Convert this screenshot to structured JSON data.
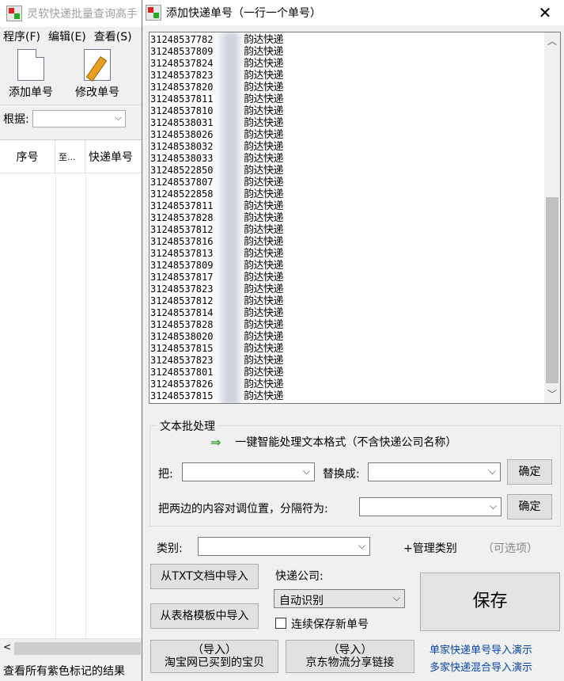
{
  "background_window": {
    "title": "灵软快递批量查询高手",
    "menu": [
      "程序(F)",
      "编辑(E)",
      "查看(S)"
    ],
    "toolbar": [
      "添加单号",
      "修改单号"
    ],
    "filter_label": "根据:",
    "grid_columns": [
      "序号",
      "至...",
      "快递单号"
    ],
    "status": "查看所有紫色标记的结果"
  },
  "dialog": {
    "title": "添加快递单号（一行一个单号）",
    "lines": [
      {
        "number": "31248537782",
        "carrier": "韵达快递"
      },
      {
        "number": "31248537809",
        "carrier": "韵达快递"
      },
      {
        "number": "31248537824",
        "carrier": "韵达快递"
      },
      {
        "number": "31248537823",
        "carrier": "韵达快递"
      },
      {
        "number": "31248537820",
        "carrier": "韵达快递"
      },
      {
        "number": "31248537811",
        "carrier": "韵达快递"
      },
      {
        "number": "31248537810",
        "carrier": "韵达快递"
      },
      {
        "number": "31248538031",
        "carrier": "韵达快递"
      },
      {
        "number": "31248538026",
        "carrier": "韵达快递"
      },
      {
        "number": "31248538032",
        "carrier": "韵达快递"
      },
      {
        "number": "31248538033",
        "carrier": "韵达快递"
      },
      {
        "number": "31248522850",
        "carrier": "韵达快递"
      },
      {
        "number": "31248537807",
        "carrier": "韵达快递"
      },
      {
        "number": "31248522858",
        "carrier": "韵达快递"
      },
      {
        "number": "31248537811",
        "carrier": "韵达快递"
      },
      {
        "number": "31248537828",
        "carrier": "韵达快递"
      },
      {
        "number": "31248537812",
        "carrier": "韵达快递"
      },
      {
        "number": "31248537816",
        "carrier": "韵达快递"
      },
      {
        "number": "31248537813",
        "carrier": "韵达快递"
      },
      {
        "number": "31248537809",
        "carrier": "韵达快递"
      },
      {
        "number": "31248537817",
        "carrier": "韵达快递"
      },
      {
        "number": "31248537823",
        "carrier": "韵达快递"
      },
      {
        "number": "31248537812",
        "carrier": "韵达快递"
      },
      {
        "number": "31248537814",
        "carrier": "韵达快递"
      },
      {
        "number": "31248537828",
        "carrier": "韵达快递"
      },
      {
        "number": "31248538020",
        "carrier": "韵达快递"
      },
      {
        "number": "31248537815",
        "carrier": "韵达快递"
      },
      {
        "number": "31248537823",
        "carrier": "韵达快递"
      },
      {
        "number": "31248537801",
        "carrier": "韵达快递"
      },
      {
        "number": "31248537826",
        "carrier": "韵达快递"
      },
      {
        "number": "31248537815",
        "carrier": "韵达快递"
      }
    ],
    "batch_group_label": "文本批处理",
    "one_click_label": "一键智能处理文本格式（不含快递公司名称）",
    "replace_label": "把:",
    "replace_with_label": "替换成:",
    "confirm_label": "确定",
    "swap_label": "把两边的内容对调位置，分隔符为:",
    "category_label": "类别:",
    "manage_category_label": "+管理类别",
    "optional_note": "（可选项）",
    "import_txt_label": "从TXT文档中导入",
    "import_template_label": "从表格模板中导入",
    "courier_label": "快递公司:",
    "courier_value": "自动识别",
    "continuous_save_label": "连续保存新单号",
    "save_label": "保存",
    "taobao_import_line1": "（导入）",
    "taobao_import_line2": "淘宝网已买到的宝贝",
    "jd_import_line1": "（导入）",
    "jd_import_line2": "京东物流分享链接",
    "demo_single_link": "单家快递单号导入演示",
    "demo_mixed_link": "多家快递混合导入演示"
  }
}
